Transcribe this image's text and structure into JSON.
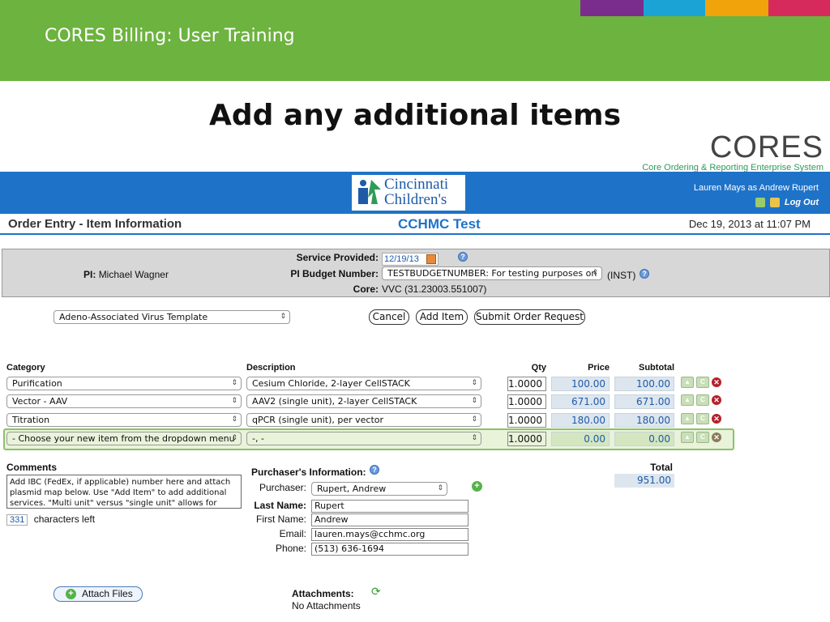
{
  "slide": {
    "title": "CORES Billing: User Training",
    "headline": "Add any additional items",
    "strip_colors": [
      "#7b2d8e",
      "#1ba3d6",
      "#f0a30a",
      "#d62a5c"
    ]
  },
  "cores_logo": {
    "word": "CORES",
    "tagline": "Core Ordering & Reporting Enterprise System"
  },
  "app_header": {
    "logo_line1": "Cincinnati",
    "logo_line2": "Children's",
    "user": "Lauren Mays as Andrew Rupert",
    "logout": "Log Out"
  },
  "title_row": {
    "page_title": "Order Entry - Item Information",
    "org": "CCHMC Test",
    "datetime": "Dec 19, 2013 at 11:07 PM"
  },
  "info": {
    "pi_label": "PI:",
    "pi_name": "Michael Wagner",
    "service_label": "Service Provided:",
    "service_date": "12/19/13",
    "budget_label": "PI Budget Number:",
    "budget_value": "TESTBUDGETNUMBER: For testing purposes on",
    "budget_suffix": "(INST)",
    "core_label": "Core:",
    "core_value": "VVC (31.23003.551007)"
  },
  "template_select": "Adeno-Associated Virus Template",
  "buttons": {
    "cancel": "Cancel",
    "add_item": "Add Item",
    "submit": "Submit Order Request"
  },
  "columns": {
    "category": "Category",
    "description": "Description",
    "qty": "Qty",
    "price": "Price",
    "subtotal": "Subtotal"
  },
  "items": [
    {
      "category": "Purification",
      "description": "Cesium Chloride, 2-layer CellSTACK",
      "qty": "1.0000",
      "price": "100.00",
      "subtotal": "100.00"
    },
    {
      "category": "Vector - AAV",
      "description": "AAV2 (single unit), 2-layer CellSTACK",
      "qty": "1.0000",
      "price": "671.00",
      "subtotal": "671.00"
    },
    {
      "category": "Titration",
      "description": "qPCR (single unit), per vector",
      "qty": "1.0000",
      "price": "180.00",
      "subtotal": "180.00"
    },
    {
      "category": "- Choose your new item from the dropdown menu",
      "description": "-, -",
      "qty": "1.0000",
      "price": "0.00",
      "subtotal": "0.00"
    }
  ],
  "comments": {
    "label": "Comments",
    "text": "Add IBC (FedEx, if applicable) number here and attach plasmid map below. Use \"Add Item\" to add additional services. \"Multi unit\" versus \"single unit\" allows for",
    "chars_left": "331",
    "chars_label": "characters left"
  },
  "purchaser": {
    "heading": "Purchaser's Information:",
    "purchaser_label": "Purchaser:",
    "purchaser_value": "Rupert, Andrew",
    "last_label": "Last Name:",
    "last_value": "Rupert",
    "first_label": "First Name:",
    "first_value": "Andrew",
    "email_label": "Email:",
    "email_value": "lauren.mays@cchmc.org",
    "phone_label": "Phone:",
    "phone_value": "(513) 636-1694"
  },
  "totals": {
    "label": "Total",
    "value": "951.00"
  },
  "attachments": {
    "button": "Attach Files",
    "heading": "Attachments:",
    "none": "No Attachments"
  }
}
